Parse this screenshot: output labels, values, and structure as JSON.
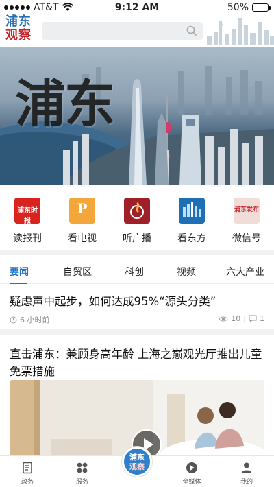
{
  "status_bar": {
    "carrier": "AT&T",
    "time": "9:12 AM",
    "battery": "50%",
    "battery_level": 0.5
  },
  "header": {
    "logo_line1": "浦东",
    "logo_line2": "观察",
    "search_placeholder": ""
  },
  "banner": {
    "calligraphy": "浦东"
  },
  "quick_entries": [
    {
      "label": "读报刊",
      "icon": "newspaper-icon",
      "badge": "浦东时报"
    },
    {
      "label": "看电视",
      "icon": "tv-icon",
      "badge": "P"
    },
    {
      "label": "听广播",
      "icon": "radio-icon",
      "badge": ""
    },
    {
      "label": "看东方",
      "icon": "east-icon",
      "badge": ""
    },
    {
      "label": "微信号",
      "icon": "wechat-icon",
      "badge": "浦东发布"
    }
  ],
  "tabs": [
    {
      "label": "要闻",
      "active": true
    },
    {
      "label": "自贸区",
      "active": false
    },
    {
      "label": "科创",
      "active": false
    },
    {
      "label": "视频",
      "active": false
    },
    {
      "label": "六大产业",
      "active": false
    }
  ],
  "articles": [
    {
      "title": "疑虑声中起步，如何达成95%“源头分类”",
      "time": "6 小时前",
      "views": "10",
      "comments": "1"
    },
    {
      "title": "直击浦东：兼顾身高年龄 上海之巅观光厅推出儿童免票措施"
    }
  ],
  "bottom_nav": [
    {
      "label": "政务",
      "icon": "government-icon"
    },
    {
      "label": "服务",
      "icon": "services-icon"
    },
    {
      "label": "",
      "icon": "home-logo-icon"
    },
    {
      "label": "全媒体",
      "icon": "media-play-icon"
    },
    {
      "label": "我的",
      "icon": "profile-icon"
    }
  ],
  "colors": {
    "accent": "#1a73c9",
    "logo_blue": "#2a6fb4",
    "logo_red": "#c8232c"
  }
}
